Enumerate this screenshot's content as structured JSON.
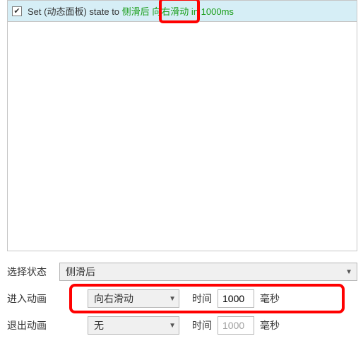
{
  "action": {
    "checked": "✔",
    "text_prefix": "Set (动态面板) state to ",
    "state": "侧滑后",
    "middle": " ",
    "direction": "向右滑动",
    "suffix": " in 1000ms"
  },
  "form": {
    "select_state_label": "选择状态",
    "select_state_value": "侧滑后",
    "enter_anim_label": "进入动画",
    "enter_anim_value": "向右滑动",
    "time_label": "时间",
    "enter_time_value": "1000",
    "unit": "毫秒",
    "exit_anim_label": "退出动画",
    "exit_anim_value": "无",
    "exit_time_value": "1000"
  },
  "icons": {
    "chevron_down": "▼"
  }
}
